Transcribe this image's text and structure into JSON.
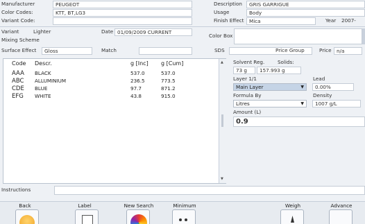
{
  "header": {
    "manufacturer_label": "Manufacturer",
    "manufacturer": "PEUGEOT",
    "color_codes_label": "Color Codes:",
    "color_codes": "KTT, BT,LG3",
    "variant_code_label": "Variant Code:",
    "variant_code": "",
    "description_label": "Description",
    "description": "GRIS GARRIGUE",
    "usage_label": "Usage",
    "usage": "Body",
    "finish_effect_label": "Finish Effect",
    "finish_effect": "Mica",
    "year_label": "Year",
    "year": "2007-",
    "variant_label": "Variant",
    "variant": "Lighter",
    "date_label": "Date",
    "date": "01/09/2009 CURRENT",
    "color_box_label": "Color Box",
    "mixing_scheme_label": "Mixing Scheme",
    "surface_effect_label": "Surface Effect",
    "surface_effect": "Gloss",
    "match_label": "Match",
    "match": "",
    "sds_label": "SDS",
    "price_group_label": "Price Group",
    "price_label": "Price",
    "price": "n/a"
  },
  "table": {
    "headers": [
      "Code",
      "Descr.",
      "g [Inc]",
      "g [Cum]"
    ],
    "rows": [
      {
        "code": "AAA",
        "descr": "BLACK",
        "inc": "537.0",
        "cum": "537.0"
      },
      {
        "code": "ABC",
        "descr": "ALLUMINIUM",
        "inc": "236.5",
        "cum": "773.5"
      },
      {
        "code": "CDE",
        "descr": "BLUE",
        "inc": "97.7",
        "cum": "871.2"
      },
      {
        "code": "EFG",
        "descr": "WHITE",
        "inc": "43.8",
        "cum": "915.0"
      }
    ]
  },
  "right": {
    "solvent_reg_label": "Solvent Reg.",
    "solids_label": "Solids:",
    "solvent_value": "73 g",
    "solids_value": "157.993 g",
    "layer_label": "Layer 1/1",
    "lead_label": "Lead",
    "layer_select": "Main Layer",
    "lead_value": "0.00%",
    "formula_by_label": "Formula By",
    "density_label": "Density",
    "formula_select": "Litres",
    "density_value": "1007 g/L",
    "amount_label": "Amount (L)",
    "amount_value": "0.9"
  },
  "instructions_label": "Instructions",
  "buttons": {
    "back": "Back",
    "label": "Label",
    "new_search": "New Search",
    "minimum": "Minimum",
    "weigh": "Weigh",
    "advance": "Advance"
  },
  "colors": {
    "accent_select": "#c5d4e6",
    "panel_border": "#b9c3cf"
  },
  "icons": [
    "chevron-down-icon",
    "scroll-up-icon",
    "scroll-down-icon",
    "back-icon",
    "label-icon",
    "color-wheel-icon",
    "minimum-icon",
    "scale-icon"
  ]
}
